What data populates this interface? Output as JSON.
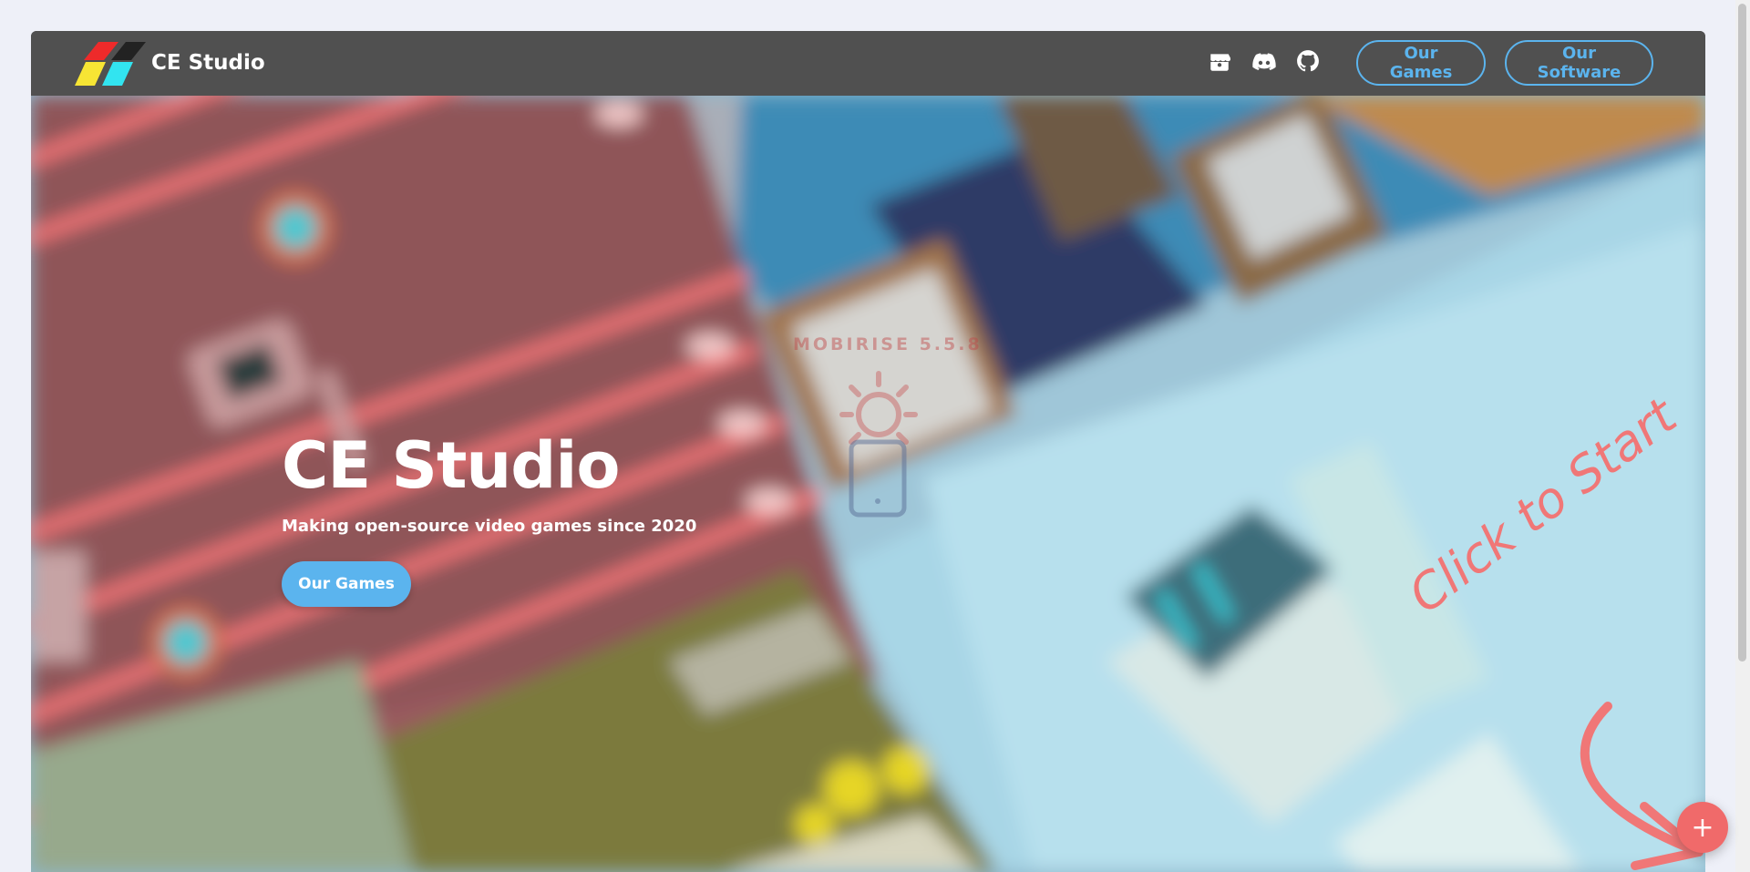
{
  "navbar": {
    "brand_name": "CE Studio",
    "social_icons": [
      "itch-io-icon",
      "discord-icon",
      "github-icon"
    ],
    "buttons": [
      "Our Games",
      "Our Software"
    ]
  },
  "hero": {
    "title": "CE Studio",
    "subtitle": "Making open-source video games since 2020",
    "cta_label": "Our Games",
    "watermark": "MOBIRISE 5.5.8"
  },
  "overlay": {
    "hint_text": "Click to Start",
    "fab_label": "+"
  },
  "colors": {
    "accent": "#5bb4ee",
    "navbar": "#505050",
    "hint": "#f07777",
    "fab": "#f06a6a"
  }
}
